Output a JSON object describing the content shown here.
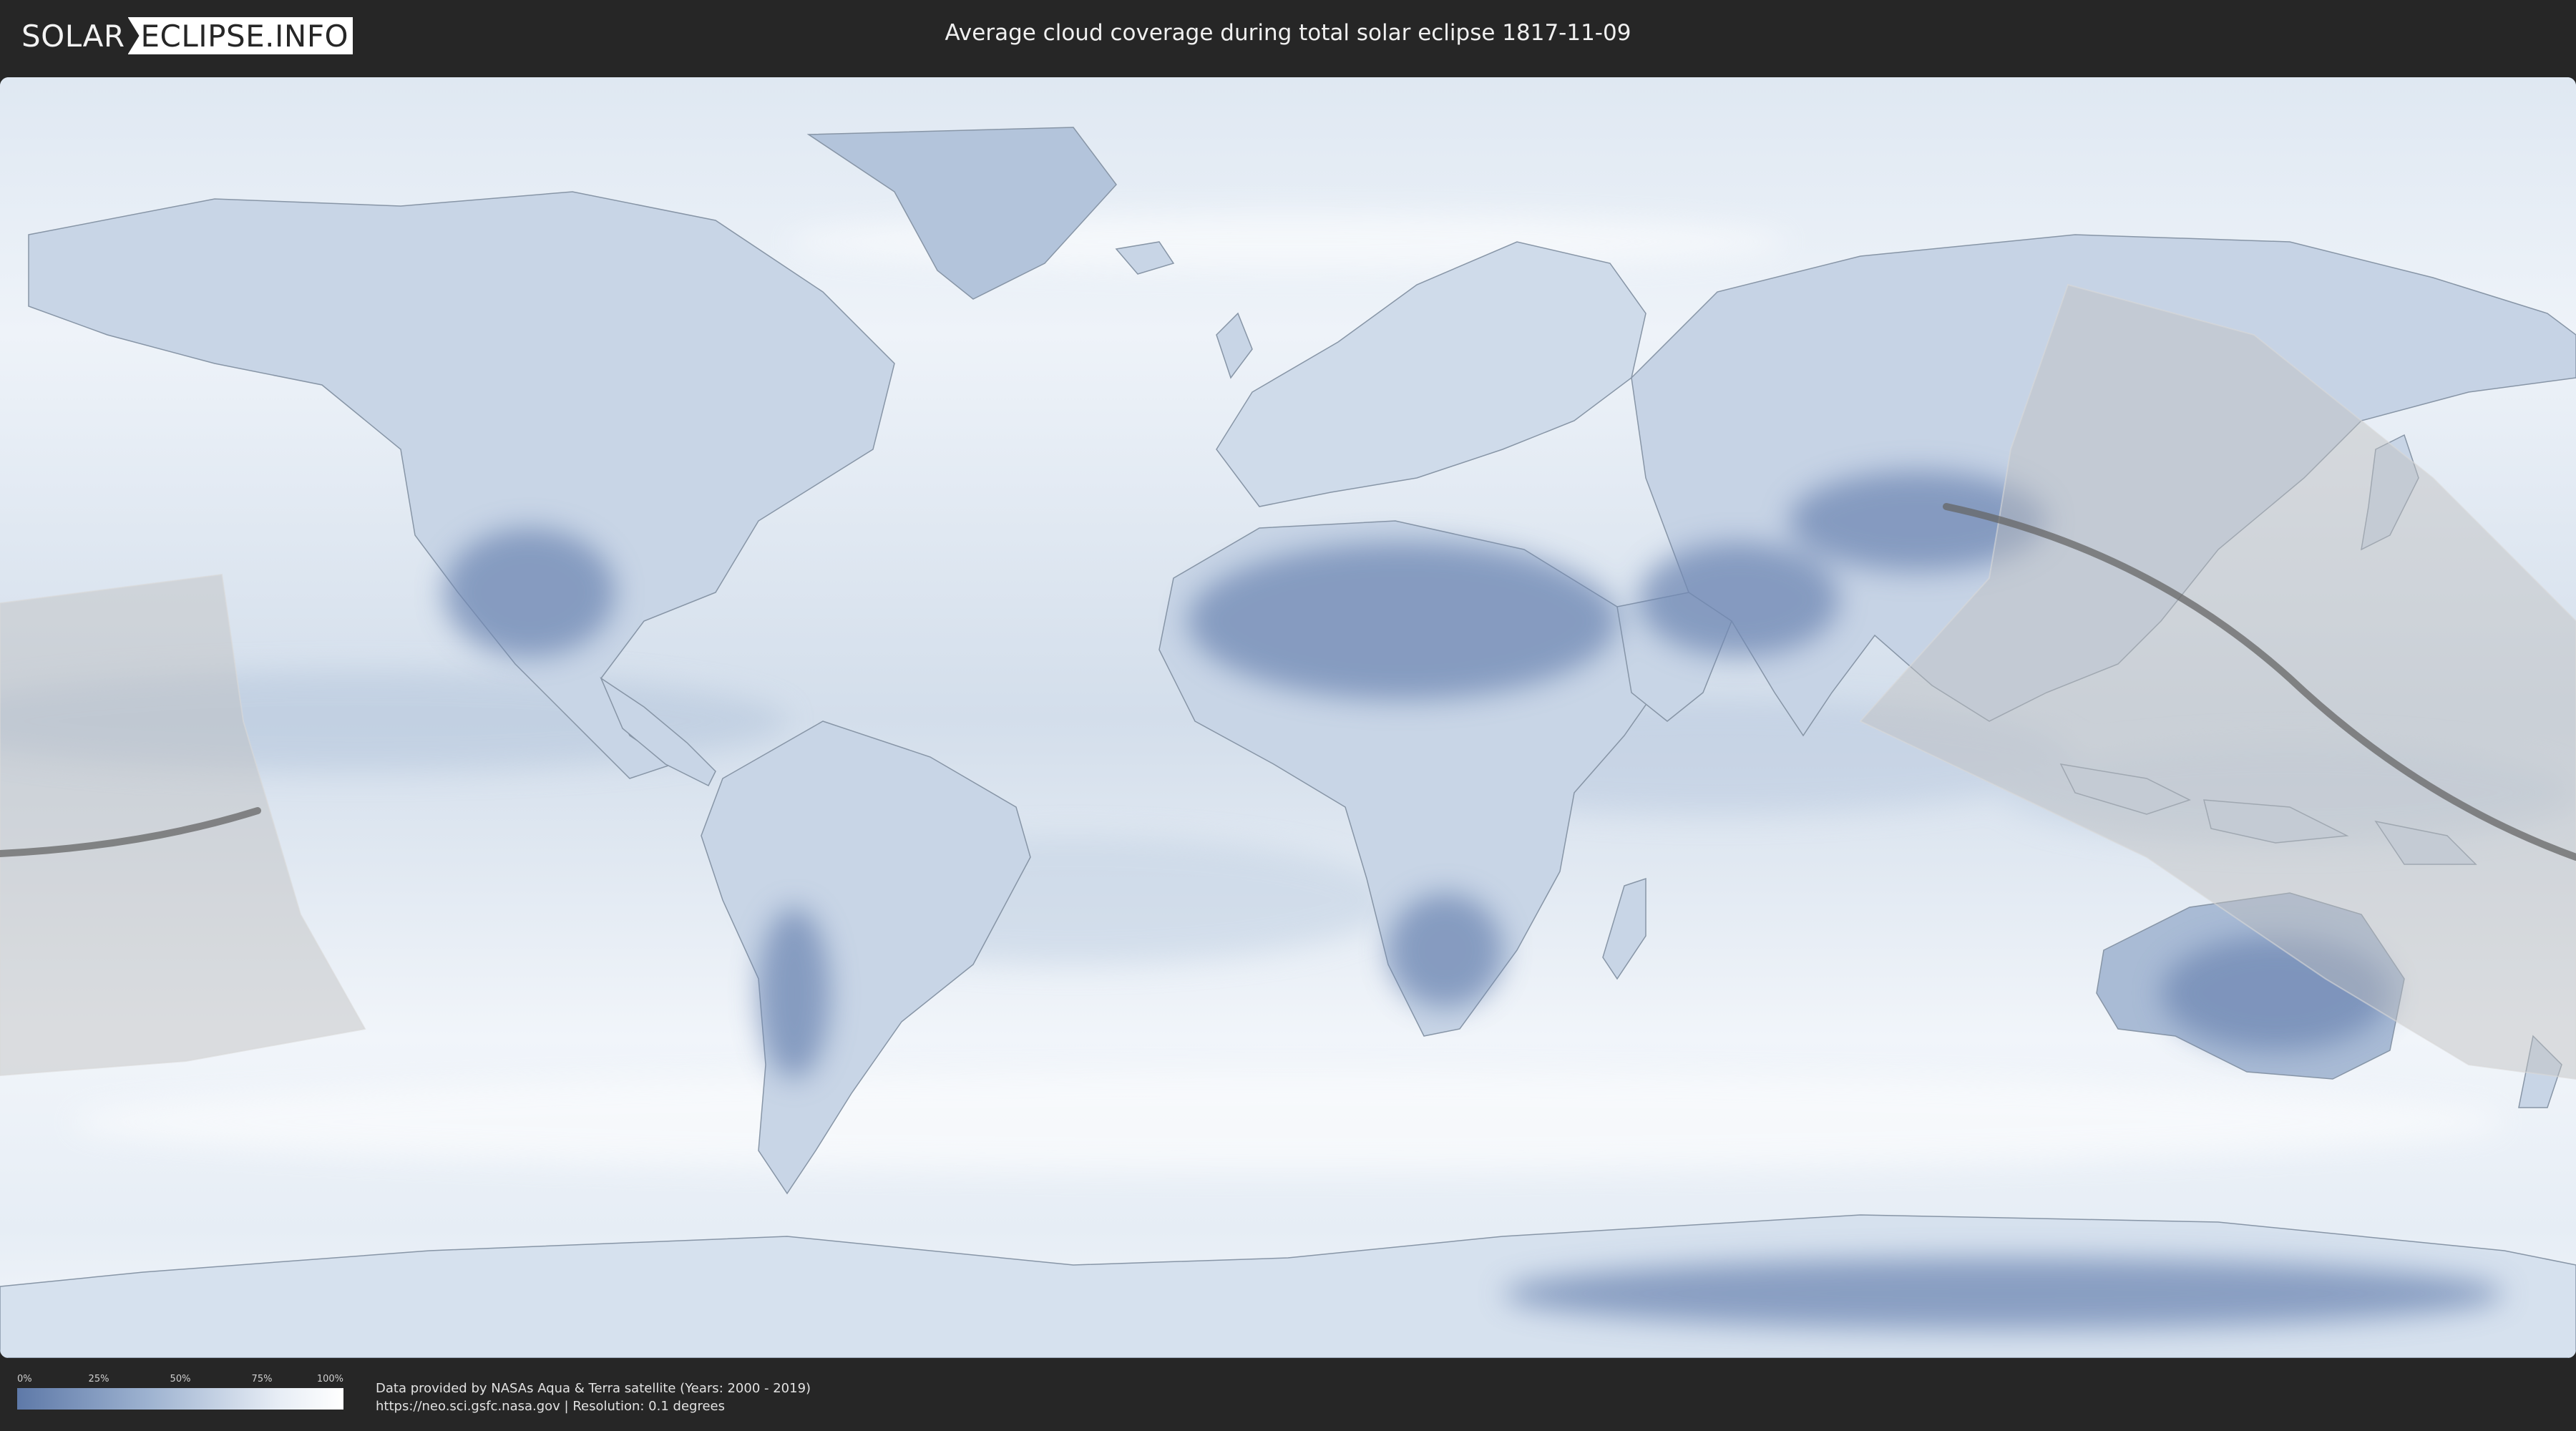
{
  "header": {
    "logo_left": "SOLAR",
    "logo_right": "ECLIPSE.INFO",
    "title": "Average cloud coverage during total solar eclipse 1817-11-09"
  },
  "map": {
    "eclipse_date": "1817-11-09",
    "colors": {
      "ocean_clear": "#eef3f9",
      "cloud_low": "#5e79a8",
      "cloud_mid": "#9db2d0",
      "border": "#7d8a99",
      "eclipse_zone": "#bfbfbf",
      "totality_path": "#666666"
    }
  },
  "legend": {
    "ticks": [
      "0%",
      "25%",
      "50%",
      "75%",
      "100%"
    ],
    "gradient_start": "#5e79a8",
    "gradient_end": "#ffffff"
  },
  "credits": {
    "line1": "Data provided by NASAs Aqua & Terra satellite (Years: 2000 - 2019)",
    "line2": "https://neo.sci.gsfc.nasa.gov | Resolution: 0.1 degrees"
  }
}
